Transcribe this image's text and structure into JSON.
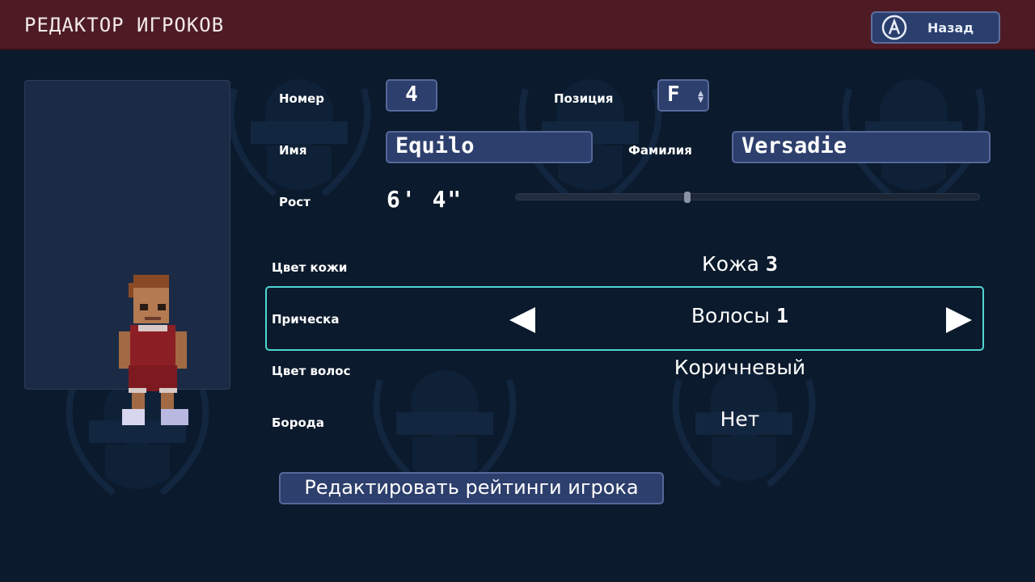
{
  "header": {
    "title": "РЕДАКТОР ИГРОКОВ",
    "back_label": "Назад",
    "back_icon": "a-button-icon",
    "bar_color": "#4e1b25"
  },
  "form": {
    "number_label": "Номер",
    "number_value": "4",
    "position_label": "Позиция",
    "position_value": "F",
    "first_name_label": "Имя",
    "first_name_value": "Equilo",
    "last_name_label": "Фамилия",
    "last_name_value": "Versadie",
    "height_label": "Рост",
    "height_value": "6' 4\"",
    "height_slider_fraction": 0.37
  },
  "appearance": {
    "skin_label": "Цвет кожи",
    "skin_value": "Кожа",
    "skin_index": "3",
    "hair_label": "Прическа",
    "hair_value": "Волосы",
    "hair_index": "1",
    "hair_color_label": "Цвет волос",
    "hair_color_value": "Коричневый",
    "beard_label": "Борода",
    "beard_value": "Нет",
    "selected_color": "#4fd6d2"
  },
  "actions": {
    "edit_ratings_label": "Редактировать рейтинги игрока"
  }
}
